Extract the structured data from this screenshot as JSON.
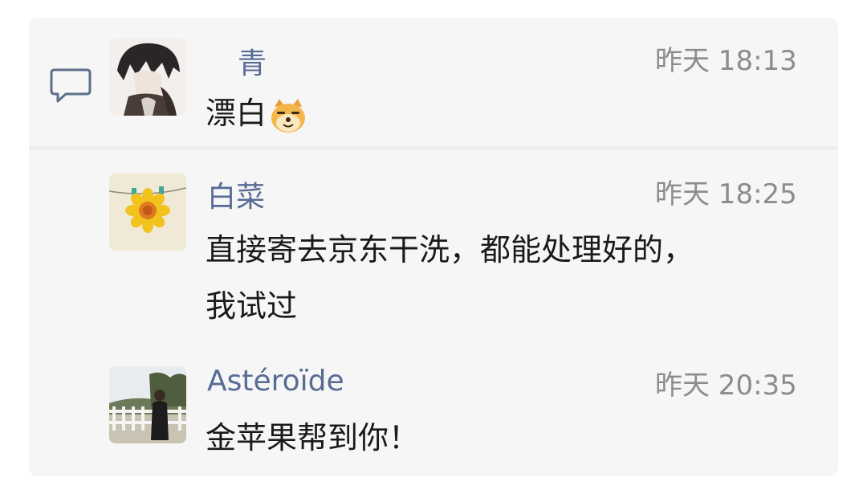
{
  "comments": [
    {
      "name": "青",
      "time": "昨天 18:13",
      "text": "漂白",
      "emoji": "doge-emoji"
    },
    {
      "name": "白菜",
      "time": "昨天 18:25",
      "text_line1": "直接寄去京东干洗，都能处理好的，",
      "text_line2": "我试过"
    },
    {
      "name": "Astéroïde",
      "time": "昨天 20:35",
      "text": "金苹果帮到你！"
    }
  ],
  "icons": {
    "comment": "speech-bubble-icon"
  },
  "colors": {
    "name": "#576b95",
    "time": "#8c8c8c",
    "text": "#1a1a1a",
    "background": "#f6f6f6"
  }
}
